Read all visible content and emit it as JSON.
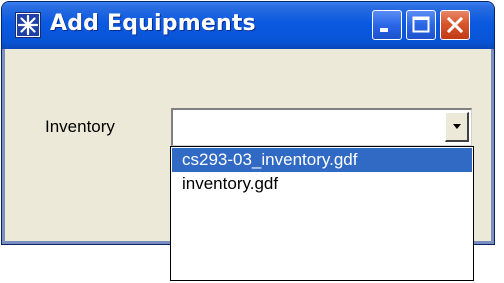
{
  "window": {
    "title": "Add Equipments",
    "icon": "star-app-icon"
  },
  "title_buttons": {
    "minimize": "minimize-icon",
    "maximize": "maximize-icon",
    "close": "close-icon"
  },
  "form": {
    "inventory_label": "Inventory",
    "inventory_value": "",
    "dropdown_arrow": "chevron-down-icon"
  },
  "dropdown": {
    "options": [
      {
        "label": "cs293-03_inventory.gdf",
        "selected": true
      },
      {
        "label": "inventory.gdf",
        "selected": false
      }
    ]
  },
  "colors": {
    "titlebar": "#0a59e1",
    "window_bg": "#ece9d8",
    "selection": "#316ac5",
    "close_button": "#d8552c"
  }
}
